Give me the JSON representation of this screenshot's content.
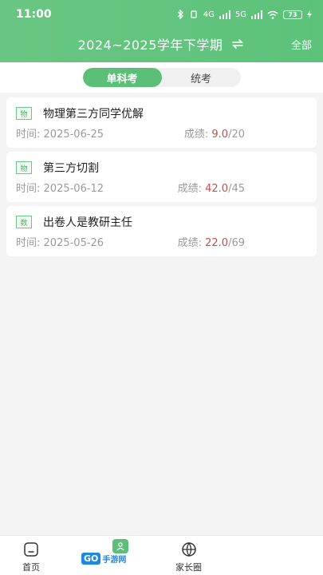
{
  "status": {
    "time": "11:00",
    "network": "4G",
    "network2": "5G",
    "battery": "73"
  },
  "header": {
    "term_title": "2024~2025学年下学期",
    "all_label": "全部"
  },
  "segment": {
    "tabs": [
      {
        "label": "单科考",
        "active": true
      },
      {
        "label": "统考",
        "active": false
      }
    ]
  },
  "exams": [
    {
      "subject": "物",
      "name": "物理第三方同学优解",
      "time_label": "时间:",
      "date": "2025-06-25",
      "score_label": "成绩:",
      "score": "9.0",
      "total": "/20"
    },
    {
      "subject": "物",
      "name": "第三方切割",
      "time_label": "时间:",
      "date": "2025-06-12",
      "score_label": "成绩:",
      "score": "42.0",
      "total": "/45"
    },
    {
      "subject": "数",
      "name": "出卷人是教研主任",
      "time_label": "时间:",
      "date": "2025-05-26",
      "score_label": "成绩:",
      "score": "22.0",
      "total": "/69"
    }
  ],
  "tabbar": {
    "home_label": "首页",
    "parent_label": "家长圈"
  },
  "watermark": {
    "logo": "GO",
    "text": "手游网"
  },
  "colors": {
    "brand_green": "#5cbf78",
    "score_red": "#c0504d"
  }
}
